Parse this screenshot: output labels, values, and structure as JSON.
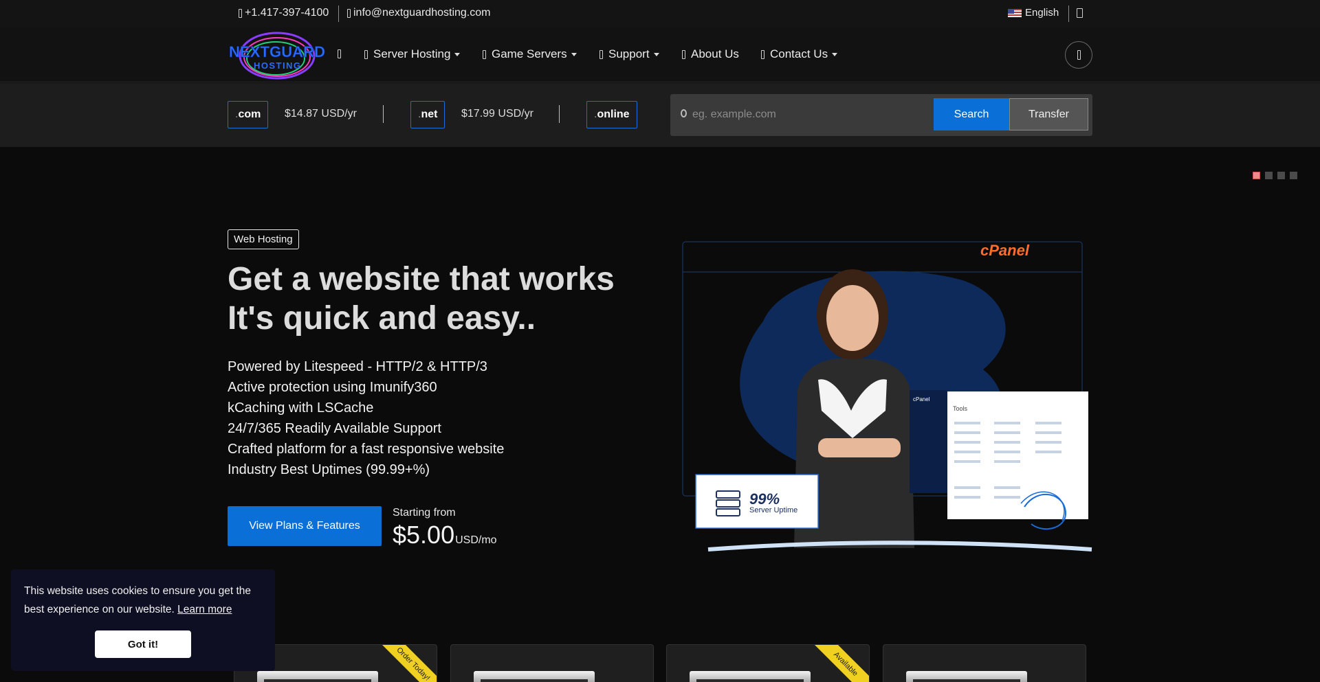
{
  "topbar": {
    "phone": "+1.417-397-4100",
    "email": "info@nextguardhosting.com",
    "language": "English"
  },
  "nav": {
    "logo_alt": "NextGuard Hosting",
    "items": [
      {
        "label": "Server Hosting",
        "has_dropdown": true
      },
      {
        "label": "Game Servers",
        "has_dropdown": true
      },
      {
        "label": "Support",
        "has_dropdown": true
      },
      {
        "label": "About Us",
        "has_dropdown": false
      },
      {
        "label": "Contact Us",
        "has_dropdown": true
      }
    ]
  },
  "domains": {
    "tlds": [
      {
        "dot": ".",
        "name": "com",
        "price": "$14.87 USD/yr"
      },
      {
        "dot": ".",
        "name": "net",
        "price": "$17.99 USD/yr"
      },
      {
        "dot": ".",
        "name": "online",
        "price": ""
      }
    ],
    "search_placeholder": "eg. example.com",
    "search_label": "Search",
    "transfer_label": "Transfer"
  },
  "hero": {
    "badge": "Web Hosting",
    "title_line1": "Get a website that works",
    "title_line2": "It's quick and easy..",
    "features": [
      "Powered by Litespeed - HTTP/2 & HTTP/3",
      "Active protection using Imunify360",
      "kCaching with LSCache",
      "24/7/365 Readily Available Support",
      "Crafted platform for a fast responsive website",
      "Industry Best Uptimes (99.99+%)"
    ],
    "cta_label": "View Plans & Features",
    "starting_label": "Starting from",
    "price": "$5.00",
    "price_unit": "USD/mo",
    "art": {
      "brand": "cPanel",
      "uptime_value": "99%",
      "uptime_label": "Server Uptime",
      "panel_title": "Tools",
      "panel_brand": "cPanel"
    }
  },
  "slider": {
    "count": 4,
    "active_index": 0
  },
  "cookie": {
    "message": "This website uses cookies to ensure you get the best experience on our website.",
    "learn_more": "Learn more",
    "accept": "Got it!"
  },
  "cards": [
    {
      "ribbon": "Order Today!"
    },
    {
      "ribbon": ""
    },
    {
      "ribbon": "Available"
    },
    {
      "ribbon": ""
    }
  ],
  "colors": {
    "accent": "#0a6fd6",
    "background": "#0b0b0c",
    "ribbon": "#f0d020",
    "cpanel": "#ff6c2c"
  }
}
